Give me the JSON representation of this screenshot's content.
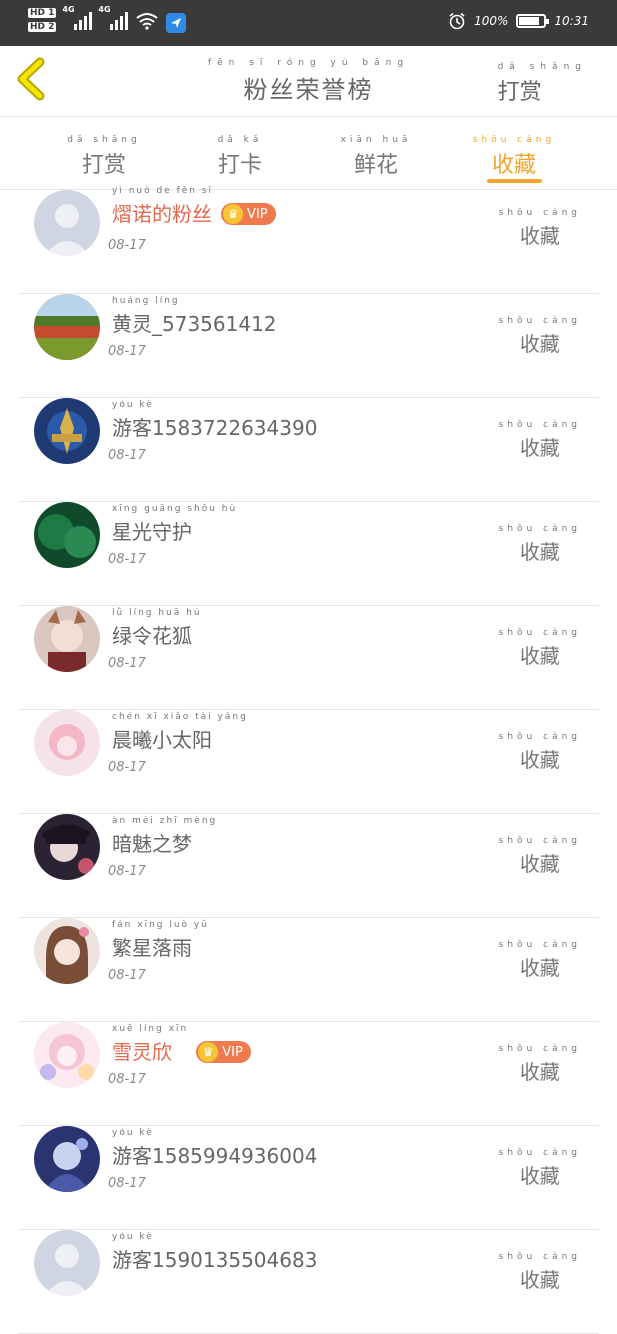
{
  "status_bar": {
    "hd1": "HD 1",
    "hd2": "HD 2",
    "net1": "4G",
    "net2": "4G",
    "battery_text": "100%",
    "battery_level": 0.8,
    "time": "10:31",
    "icons": [
      "alarm-icon",
      "wifi-icon",
      "battery-icon"
    ]
  },
  "header": {
    "title": "粉丝荣誉榜",
    "title_pinyin": "fěn sī róng yù bǎng",
    "right_link": "打赏",
    "right_link_pinyin": "dǎ shǎng"
  },
  "tabs": [
    {
      "label": "打赏",
      "pinyin": "dǎ shǎng",
      "active": false
    },
    {
      "label": "打卡",
      "pinyin": "dǎ kǎ",
      "active": false
    },
    {
      "label": "鲜花",
      "pinyin": "xiān huā",
      "active": false
    },
    {
      "label": "收藏",
      "pinyin": "shōu cáng",
      "active": true
    }
  ],
  "accent_color": "#f2a431",
  "vip_color": "#e36a4e",
  "list": [
    {
      "name": "熠诺的粉丝",
      "pinyin": "yì nuò de fěn sī",
      "date": "08-17",
      "action": "收藏",
      "action_pinyin": "shōu cáng",
      "vip": "VIP",
      "avatar": "default-avatar"
    },
    {
      "name": "黄灵_573561412",
      "pinyin": "huáng líng",
      "date": "08-17",
      "action": "收藏",
      "action_pinyin": "shōu cáng",
      "avatar": "landscape-avatar"
    },
    {
      "name": "游客1583722634390",
      "pinyin": "yóu kè",
      "date": "08-17",
      "action": "收藏",
      "action_pinyin": "shōu cáng",
      "avatar": "game-emblem-avatar"
    },
    {
      "name": "星光守护",
      "pinyin": "xīng guāng shǒu hù",
      "date": "08-17",
      "action": "收藏",
      "action_pinyin": "shōu cáng",
      "avatar": "green-avatar"
    },
    {
      "name": "绿令花狐",
      "pinyin": "lǜ líng huā hú",
      "date": "08-17",
      "action": "收藏",
      "action_pinyin": "shōu cáng",
      "avatar": "anime-fox-avatar"
    },
    {
      "name": "晨曦小太阳",
      "pinyin": "chén xī xiǎo tài yáng",
      "date": "08-17",
      "action": "收藏",
      "action_pinyin": "shōu cáng",
      "avatar": "pink-anime-avatar"
    },
    {
      "name": "暗魅之梦",
      "pinyin": "àn mèi zhī mèng",
      "date": "08-17",
      "action": "收藏",
      "action_pinyin": "shōu cáng",
      "avatar": "dark-anime-avatar"
    },
    {
      "name": "繁星落雨",
      "pinyin": "fán xīng luò yǔ",
      "date": "08-17",
      "action": "收藏",
      "action_pinyin": "shōu cáng",
      "avatar": "brown-hair-anime-avatar"
    },
    {
      "name": "雪灵欣",
      "pinyin": "xuě líng xīn",
      "date": "08-17",
      "action": "收藏",
      "action_pinyin": "shōu cáng",
      "vip": "VIP",
      "avatar": "pastel-anime-avatar"
    },
    {
      "name": "游客1585994936004",
      "pinyin": "yóu kè",
      "date": "08-17",
      "action": "收藏",
      "action_pinyin": "shōu cáng",
      "avatar": "blue-anime-avatar"
    },
    {
      "name": "游客1590135504683",
      "pinyin": "yóu kè",
      "date": "",
      "action": "收藏",
      "action_pinyin": "shōu cáng",
      "avatar": "default-avatar"
    }
  ]
}
